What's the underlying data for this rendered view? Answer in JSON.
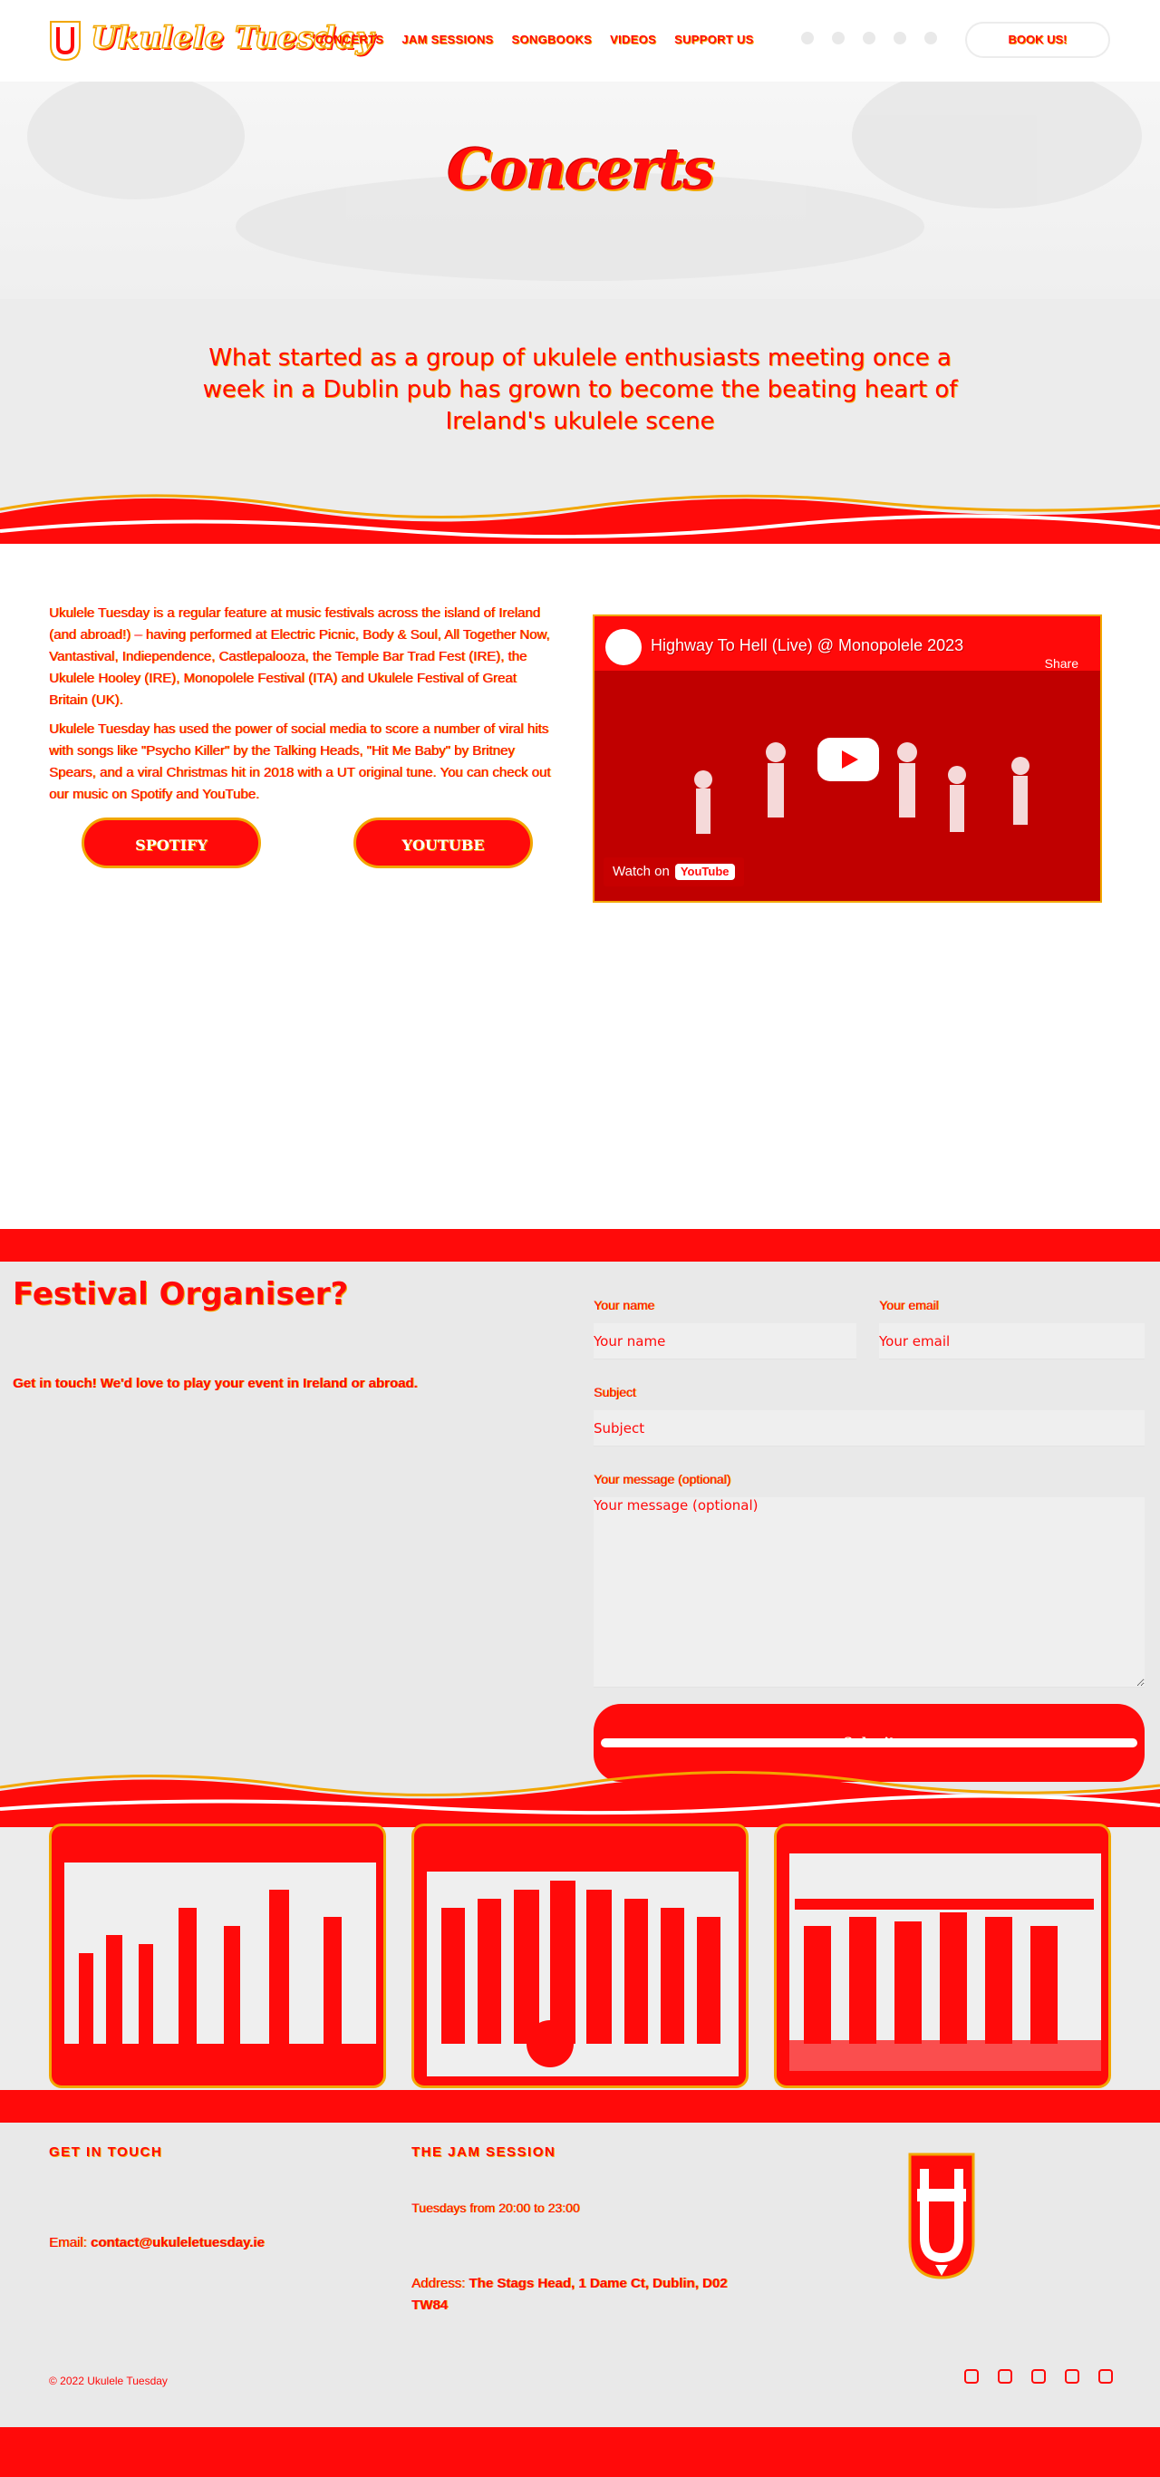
{
  "brand": {
    "name": "Ukulele Tuesday"
  },
  "nav": {
    "items": [
      "CONCERTS",
      "JAM SESSIONS",
      "SONGBOOKS",
      "VIDEOS",
      "SUPPORT US"
    ],
    "book_label": "BOOK US!"
  },
  "hero": {
    "title": "Concerts"
  },
  "intro": {
    "text": "What started as a group of ukulele enthusiasts meeting once a week in a Dublin pub has grown to become the beating heart of Ireland's ukulele scene"
  },
  "body": {
    "paragraph_1": "Ukulele Tuesday is a regular feature at music festivals across the island of Ireland (and abroad!) – having performed at Electric Picnic, Body & Soul, All Together Now, Vantastival, Indiependence, Castlepalooza, the Temple Bar Trad Fest (IRE), the Ukulele Hooley (IRE), Monopolele Festival (ITA) and Ukulele Festival of Great Britain (UK).",
    "paragraph_2": "Ukulele Tuesday has used the power of social media to score a number of viral hits with songs like \"Psycho Killer\" by the Talking Heads, \"Hit Me Baby\" by Britney Spears, and a viral Christmas hit in 2018 with a UT original tune. You can check out our music on Spotify and YouTube.",
    "spotify_label": "SPOTIFY",
    "youtube_label": "YOUTUBE"
  },
  "video": {
    "title": "Highway To Hell (Live) @ Monopolele 2023",
    "share": "Share",
    "watch_on": "Watch on",
    "platform": "YouTube"
  },
  "organiser": {
    "title": "Festival Organiser?",
    "subtitle": "Get in touch! We'd love to play your event in Ireland or abroad.",
    "form": {
      "name_label": "Your name",
      "name_placeholder": "Your name",
      "email_label": "Your email",
      "email_placeholder": "Your email",
      "subject_label": "Subject",
      "subject_placeholder": "Subject",
      "message_label": "Your message (optional)",
      "message_placeholder": "Your message (optional)",
      "submit_label": "Submit"
    }
  },
  "footer": {
    "contact_heading": "GET IN TOUCH",
    "email_label": "Email:",
    "email_value": "contact@ukuleletuesday.ie",
    "jam_heading": "THE JAM SESSION",
    "jam_time": "Tuesdays from 20:00 to 23:00",
    "address_label": "Address:",
    "address_value": "The Stags Head, 1 Dame Ct, Dublin, D02 TW84",
    "copyright": "© 2022 Ukulele Tuesday"
  },
  "icons": [
    "instagram-icon",
    "facebook-icon",
    "whatsapp-icon",
    "email-icon",
    "youtube-icon"
  ],
  "colors": {
    "accent": "#ff0a0a",
    "gold": "#f2a600",
    "background": "#ececec"
  }
}
